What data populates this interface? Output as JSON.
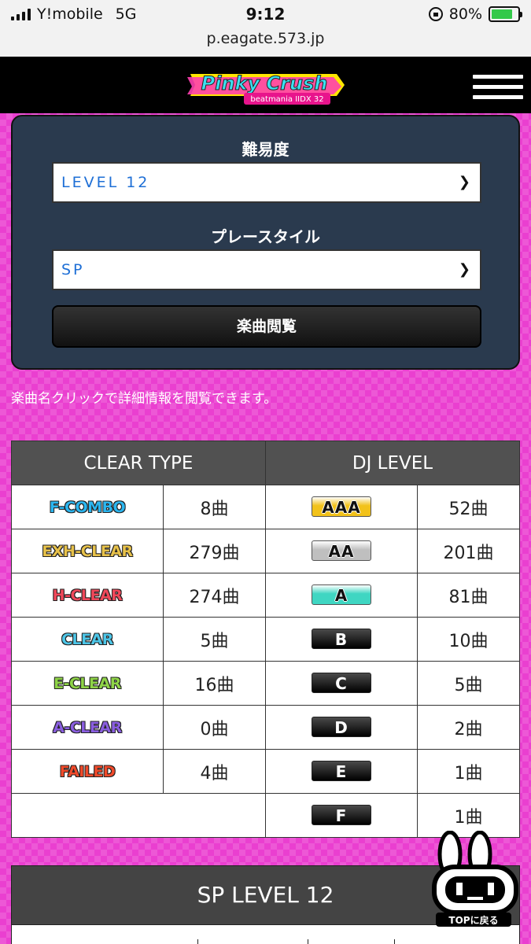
{
  "status": {
    "carrier": "Y!mobile",
    "network": "5G",
    "time": "9:12",
    "battery": "80%",
    "url": "p.eagate.573.jp"
  },
  "header": {
    "logo_text": "Pinky Crush",
    "logo_sub": "beatmania IIDX 32",
    "menu_icon": "hamburger-menu-icon"
  },
  "filter": {
    "difficulty_label": "難易度",
    "difficulty_value": "LEVEL 12",
    "style_label": "プレースタイル",
    "style_value": "SP",
    "browse_button": "楽曲閲覧"
  },
  "note": "楽曲名クリックで詳細情報を閲覧できます。",
  "stats": {
    "clear_header": "CLEAR TYPE",
    "dj_header": "DJ LEVEL",
    "clear_rows": [
      {
        "label": "F-COMBO",
        "count": "8曲",
        "color": "#2bb6f0"
      },
      {
        "label": "EXH-CLEAR",
        "count": "279曲",
        "color": "#e8c24a"
      },
      {
        "label": "H-CLEAR",
        "count": "274曲",
        "color": "#f0485a"
      },
      {
        "label": "CLEAR",
        "count": "5曲",
        "color": "#4dc6e8"
      },
      {
        "label": "E-CLEAR",
        "count": "16曲",
        "color": "#8fd448"
      },
      {
        "label": "A-CLEAR",
        "count": "0曲",
        "color": "#8a5ee0"
      },
      {
        "label": "FAILED",
        "count": "4曲",
        "color": "#f04a2a"
      }
    ],
    "dj_rows": [
      {
        "label": "AAA",
        "count": "52曲",
        "color": "#f2c21a"
      },
      {
        "label": "AA",
        "count": "201曲",
        "color": "#bfbfbf"
      },
      {
        "label": "A",
        "count": "81曲",
        "color": "#3fd6c2"
      },
      {
        "label": "B",
        "count": "10曲",
        "color": "#222222"
      },
      {
        "label": "C",
        "count": "5曲",
        "color": "#222222"
      },
      {
        "label": "D",
        "count": "2曲",
        "color": "#222222"
      },
      {
        "label": "E",
        "count": "1曲",
        "color": "#222222"
      },
      {
        "label": "F",
        "count": "1曲",
        "color": "#222222"
      }
    ]
  },
  "level_section": {
    "title": "SP LEVEL 12"
  },
  "top_button": {
    "label": "TOPに戻る"
  }
}
